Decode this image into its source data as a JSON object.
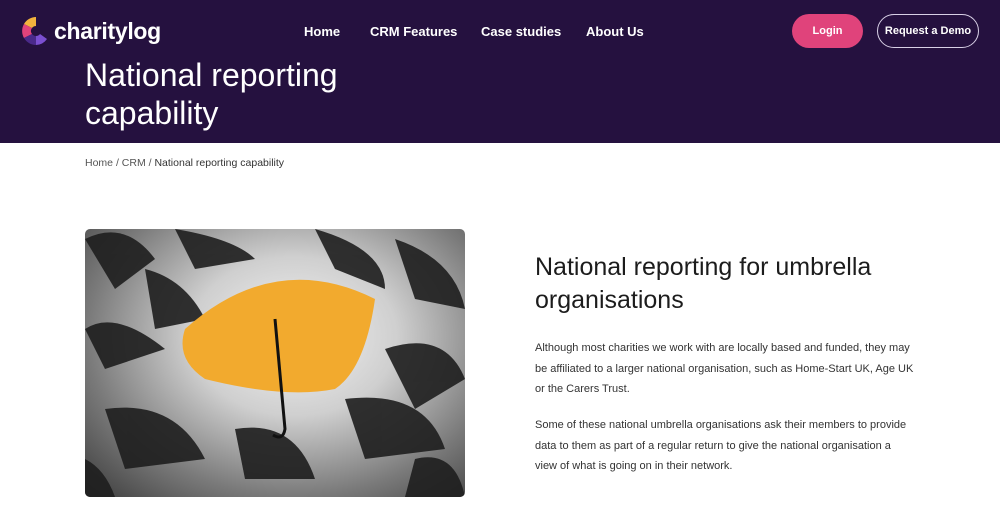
{
  "header": {
    "logo_text": "charitylog",
    "nav": [
      "Home",
      "CRM Features",
      "Case studies",
      "About Us"
    ],
    "login": "Login",
    "demo": "Request a Demo",
    "title": "National reporting capability"
  },
  "breadcrumb": {
    "items": [
      "Home",
      "CRM"
    ],
    "current": "National reporting capability",
    "sep": "/"
  },
  "content": {
    "heading": "National reporting for umbrella organisations",
    "paragraphs": [
      "Although most charities we work with are locally based and funded, they may be affiliated to a larger national organisation, such as Home-Start UK, Age UK or the Carers Trust.",
      "Some of these national umbrella organisations ask their members to provide data to them as part of a regular return to give the national organisation a view of what is going on in their network."
    ]
  },
  "colors": {
    "header_bg": "#25113f",
    "accent": "#e0437b"
  }
}
